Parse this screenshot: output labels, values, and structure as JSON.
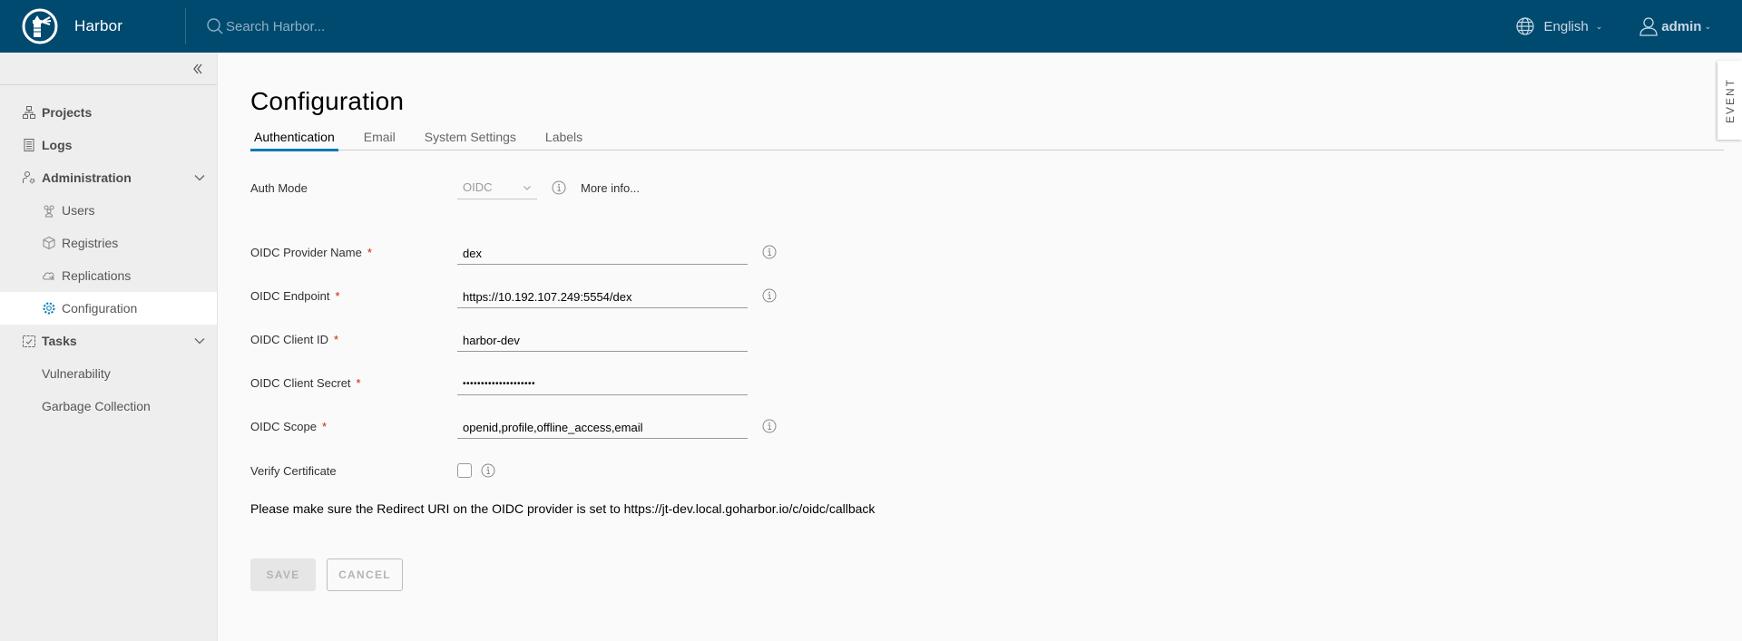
{
  "header": {
    "app_name": "Harbor",
    "logo_icon": "harbor-lighthouse-logo",
    "search_placeholder": "Search Harbor...",
    "language": "English",
    "user": "admin",
    "background_color": "#004a70"
  },
  "sidebar": {
    "collapse_icon": "double-chevron-left-icon",
    "items": [
      {
        "label": "Projects",
        "icon": "projects-icon",
        "level": 0
      },
      {
        "label": "Logs",
        "icon": "logs-icon",
        "level": 0
      },
      {
        "label": "Administration",
        "icon": "administration-icon",
        "level": 0,
        "expanded": true
      },
      {
        "label": "Users",
        "icon": "users-icon",
        "level": 1
      },
      {
        "label": "Registries",
        "icon": "registries-icon",
        "level": 1
      },
      {
        "label": "Replications",
        "icon": "replications-icon",
        "level": 1
      },
      {
        "label": "Configuration",
        "icon": "configuration-icon",
        "level": 1,
        "active": true
      },
      {
        "label": "Tasks",
        "icon": "tasks-icon",
        "level": 0,
        "expanded": true
      },
      {
        "label": "Vulnerability",
        "level": 1
      },
      {
        "label": "Garbage Collection",
        "level": 1
      }
    ]
  },
  "main": {
    "title": "Configuration",
    "tabs": [
      {
        "label": "Authentication",
        "active": true
      },
      {
        "label": "Email"
      },
      {
        "label": "System Settings"
      },
      {
        "label": "Labels"
      }
    ],
    "form": {
      "auth_mode": {
        "label": "Auth Mode",
        "value": "OIDC",
        "more_info": "More info..."
      },
      "provider_name": {
        "label": "OIDC Provider Name",
        "required": "*",
        "value": "dex"
      },
      "endpoint": {
        "label": "OIDC Endpoint",
        "required": "*",
        "value": "https://10.192.107.249:5554/dex"
      },
      "client_id": {
        "label": "OIDC Client ID",
        "required": "*",
        "value": "harbor-dev"
      },
      "client_secret": {
        "label": "OIDC Client Secret",
        "required": "*",
        "value": "••••••••••••••••••••"
      },
      "scope": {
        "label": "OIDC Scope",
        "required": "*",
        "value": "openid,profile,offline_access,email"
      },
      "verify_certificate": {
        "label": "Verify Certificate",
        "checked": false
      }
    },
    "note": "Please make sure the Redirect URI on the OIDC provider is set to https://jt-dev.local.goharbor.io/c/oidc/callback",
    "buttons": {
      "save": "SAVE",
      "cancel": "CANCEL"
    },
    "accent_color": "#0079b8"
  },
  "event_tab": {
    "label": "EVENT"
  }
}
